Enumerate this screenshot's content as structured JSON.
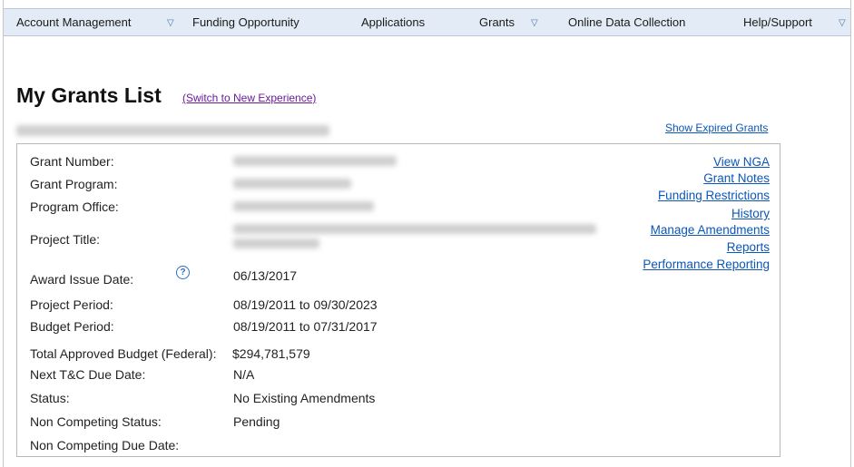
{
  "nav": {
    "items": [
      "Account Management",
      "Funding Opportunity",
      "Applications",
      "Grants",
      "Online Data Collection",
      "Help/Support"
    ]
  },
  "page": {
    "title": "My Grants List",
    "switch_link": "(Switch to New Experience)",
    "expired_link": "Show Expired Grants"
  },
  "grant": {
    "labels": {
      "grant_number": "Grant Number:",
      "grant_program": "Grant Program:",
      "program_office": "Program Office:",
      "project_title": "Project Title:",
      "award_issue_date": "Award Issue Date:",
      "project_period": "Project Period:",
      "budget_period": "Budget Period:",
      "total_budget": "Total Approved Budget (Federal):",
      "next_tc": "Next T&C Due Date:",
      "status": "Status:",
      "non_competing_status": "Non Competing Status:",
      "non_competing_due": "Non Competing Due Date:"
    },
    "values": {
      "award_issue_date": "06/13/2017",
      "project_period": "08/19/2011 to 09/30/2023",
      "budget_period": "08/19/2011 to 07/31/2017",
      "total_budget": "$294,781,579",
      "next_tc": "N/A",
      "status": "No Existing Amendments",
      "non_competing_status": "Pending"
    },
    "help_icon_glyph": "?"
  },
  "actions": [
    "View NGA",
    "Grant Notes",
    "Funding Restrictions",
    "History",
    "Manage Amendments",
    "Reports",
    "Performance Reporting"
  ],
  "colors": {
    "link": "#0b56b8",
    "visited_link": "#6a1b9a",
    "nav_bg": "#e3ecf6",
    "icon": "#2a6fc9"
  }
}
